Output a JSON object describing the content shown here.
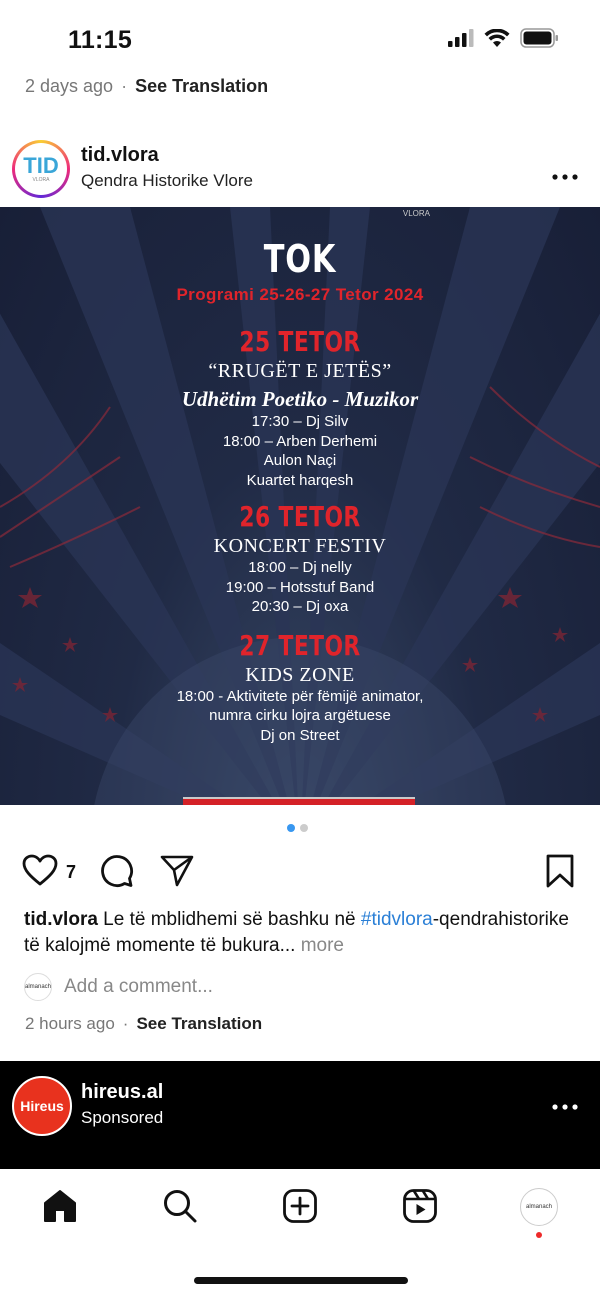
{
  "status_bar": {
    "time": "11:15",
    "icons": [
      "signal-icon",
      "wifi-icon",
      "battery-icon"
    ]
  },
  "previous_post": {
    "time_ago": "2 days ago",
    "separator": "·",
    "see_translation": "See Translation"
  },
  "post": {
    "username": "tid.vlora",
    "location": "Qendra Historike Vlore",
    "more_icon": "more-dots-icon",
    "avatar": {
      "text": "TID",
      "subtext": "VLORA"
    },
    "poster": {
      "logo": "VLORA",
      "title": "TOK",
      "subtitle": "Programi  25-26-27 Tetor 2024",
      "days": [
        {
          "label": "25 TETOR",
          "event": "“RRUGËT E JETËS”",
          "italic": "Udhëtim Poetiko - Muzikor",
          "lines": [
            "17:30 –  Dj Silv",
            "18:00 –  Arben Derhemi",
            "Aulon Naçi",
            "Kuartet harqesh"
          ]
        },
        {
          "label": "26 TETOR",
          "event": "KONCERT  FESTIV",
          "lines": [
            "18:00 – Dj nelly",
            "19:00 – Hotsstuf Band",
            "20:30 – Dj oxa"
          ]
        },
        {
          "label": "27 TETOR",
          "event": "KIDS ZONE",
          "lines": [
            "18:00 - Aktivitete për fëmijë animator,",
            "numra cirku lojra argëtuese",
            "Dj on Street"
          ]
        }
      ]
    },
    "carousel": {
      "total": 2,
      "active": 1
    },
    "likes": "7",
    "caption": {
      "username": "tid.vlora",
      "text_before": " Le të mblidhemi së bashku në ",
      "hashtag": "#tidvlora",
      "text_after": "-qendrahistorike të kalojmë momente të bukura...",
      "more": " more"
    },
    "comment": {
      "placeholder": "Add a comment...",
      "avatar_text": "almanach"
    },
    "meta": {
      "time_ago": "2 hours ago",
      "separator": "·",
      "see_translation": "See Translation"
    }
  },
  "sponsored": {
    "username": "hireus.al",
    "label": "Sponsored",
    "avatar_text": "Hireus"
  },
  "tab_bar": {
    "items": [
      "home-icon",
      "search-icon",
      "create-icon",
      "reels-icon",
      "profile-avatar"
    ],
    "profile_avatar_text": "almanach"
  }
}
